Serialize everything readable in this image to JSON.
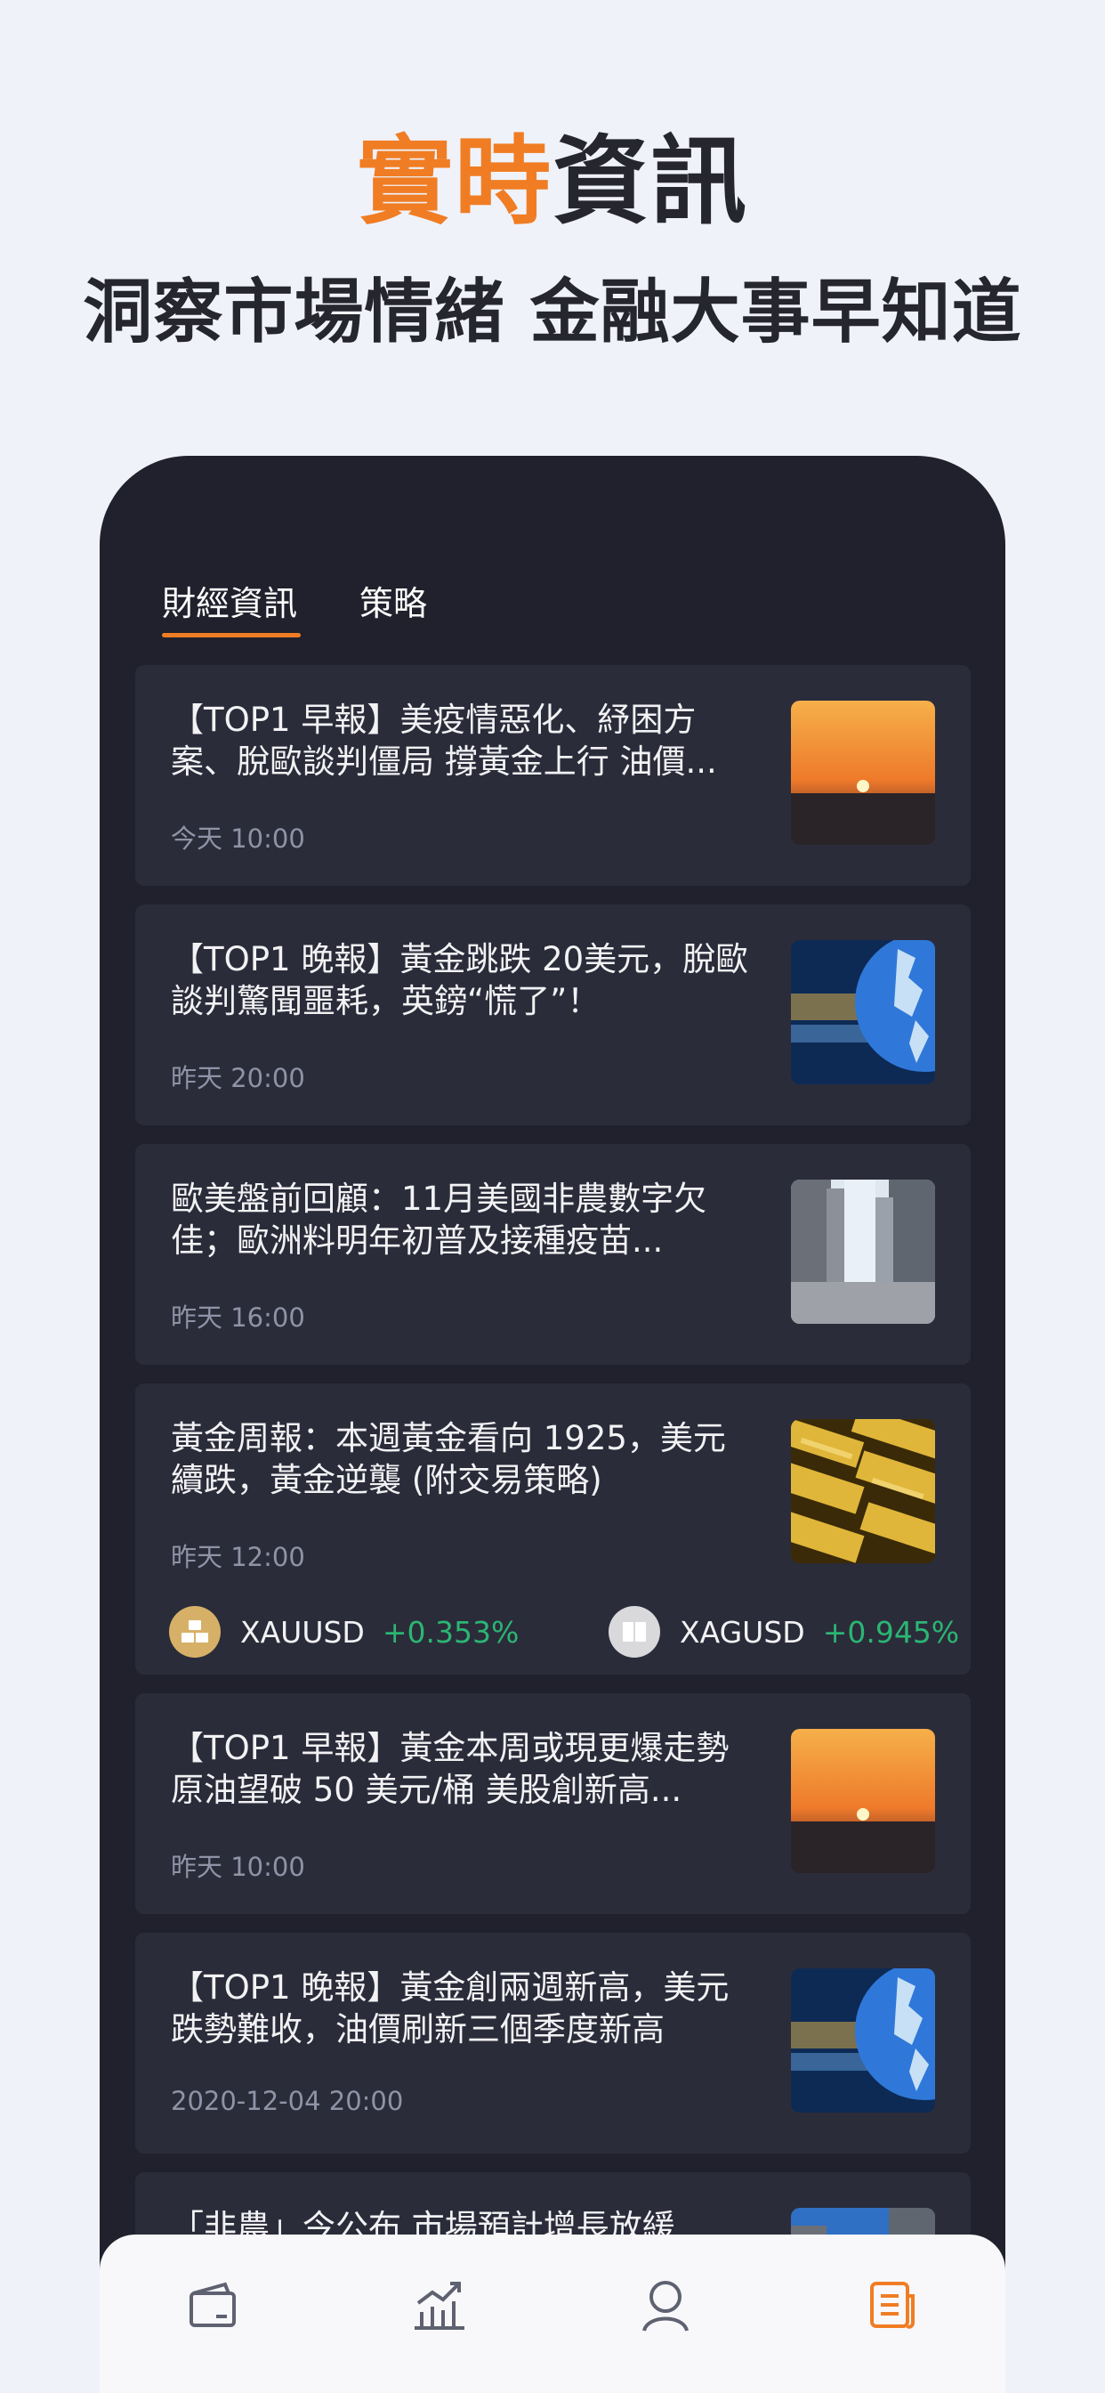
{
  "hero": {
    "title_accent": "實時",
    "title_rest": "資訊",
    "subtitle": "洞察市場情緒 金融大事早知道"
  },
  "tabs": [
    {
      "label": "財經資訊",
      "active": true
    },
    {
      "label": "策略",
      "active": false
    }
  ],
  "news": [
    {
      "title": "【TOP1 早報】美疫情惡化、紓困方案、脫歐談判僵局 撐黃金上行 油價...",
      "time": "今天 10:00",
      "thumb": "sunset-image"
    },
    {
      "title": "【TOP1 晚報】黃金跳跌 20美元，脫歐談判驚聞噩耗，英鎊“慌了”！",
      "time": "昨天 20:00",
      "thumb": "globe-image"
    },
    {
      "title": "歐美盤前回顧：11月美國非農數字欠佳；歐洲料明年初普及接種疫苗...",
      "time": "昨天 16:00",
      "thumb": "city-street-image"
    },
    {
      "title": "黃金周報：本週黃金看向 1925，美元續跌，黃金逆襲 (附交易策略)",
      "time": "昨天 12:00",
      "thumb": "gold-bars-image",
      "tickers": [
        {
          "symbol": "XAUUSD",
          "change": "+0.353%",
          "coin": "gold-coin-icon",
          "color": "#d7b068"
        },
        {
          "symbol": "XAGUSD",
          "change": "+0.945%",
          "coin": "silver-coin-icon",
          "color": "#d9d9dc"
        }
      ]
    },
    {
      "title": "【TOP1 早報】黃金本周或現更爆走勢  原油望破 50 美元/桶  美股創新高...",
      "time": "昨天 10:00",
      "thumb": "sunset-image"
    },
    {
      "title": "【TOP1 晚報】黃金創兩週新高，美元跌勢難收，油價刷新三個季度新高",
      "time": "2020-12-04 20:00",
      "thumb": "globe-image"
    },
    {
      "title": "「非農」今公布 市場預計增長放緩",
      "time": "",
      "thumb": "city-street-image"
    }
  ],
  "bottom_nav": [
    {
      "icon": "wallet-icon",
      "active": false
    },
    {
      "icon": "chart-icon",
      "active": false
    },
    {
      "icon": "profile-icon",
      "active": false
    },
    {
      "icon": "news-icon",
      "active": true
    }
  ],
  "colors": {
    "accent": "#f07d24",
    "positive": "#2bb673",
    "card": "#2b2c3a",
    "panel": "#20212c"
  }
}
